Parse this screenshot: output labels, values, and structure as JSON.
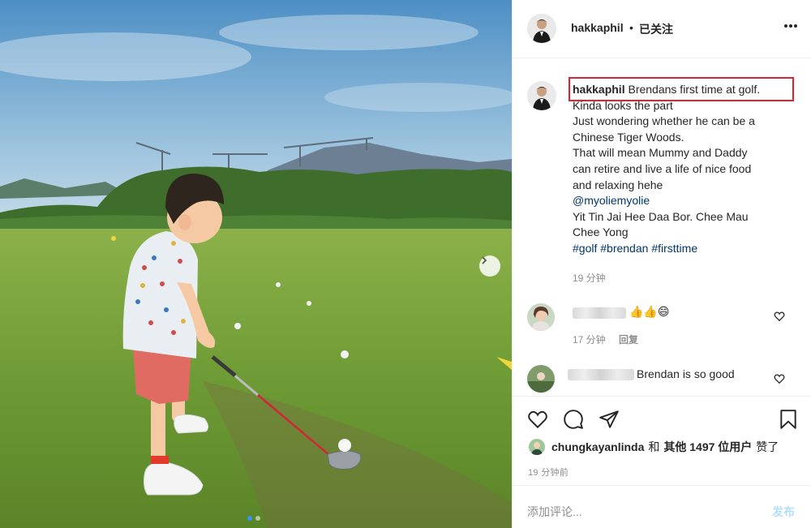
{
  "header": {
    "username": "hakkaphil",
    "separator": "•",
    "follow_status": "已关注",
    "more": "•••"
  },
  "caption": {
    "username": "hakkaphil",
    "first_line": "Brendans first time at golf.",
    "lines": [
      "Kinda looks the part",
      "Just wondering whether he can be a",
      "Chinese Tiger Woods.",
      "That will mean Mummy and Daddy",
      "can retire and live a life of nice food",
      "and relaxing hehe"
    ],
    "mention": "@myoliemyolie",
    "lines2": [
      "Yit Tin Jai Hee Daa Bor. Chee Mau",
      "Chee Yong"
    ],
    "hashtags": [
      "#golf",
      "#brendan",
      "#firsttime"
    ],
    "time": "19 分钟"
  },
  "comments": [
    {
      "text": "👍👍😄",
      "time": "17 分钟",
      "reply": "回复"
    },
    {
      "text": "Brendan is so good"
    }
  ],
  "likes": {
    "user": "chungkayanlinda",
    "middle": "和",
    "others": "其他 1497 位用户",
    "suffix": "赞了"
  },
  "post_time": "19 分钟前",
  "add_comment": {
    "placeholder": "添加评论...",
    "post_label": "发布"
  },
  "colors": {
    "highlight_box": "#e0242b",
    "link": "#00376b",
    "muted": "#8e8e8e",
    "post_disabled": "#b2dffc",
    "active_dot": "#3897f0"
  },
  "icons": [
    "chevron-right-icon",
    "more-icon",
    "heart-icon",
    "comment-icon",
    "share-icon",
    "bookmark-icon"
  ]
}
